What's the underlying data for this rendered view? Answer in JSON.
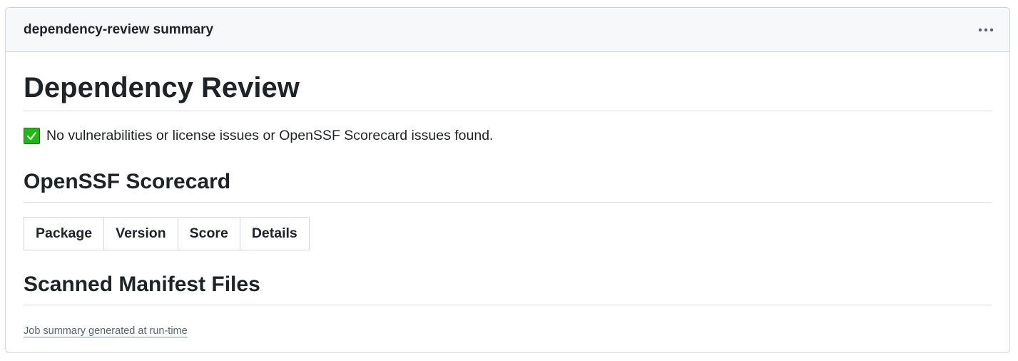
{
  "header": {
    "title": "dependency-review summary",
    "menu_icon": "kebab-horizontal-icon"
  },
  "content": {
    "title": "Dependency Review",
    "status": {
      "icon": "check-mark-icon",
      "text": "No vulnerabilities or license issues or OpenSSF Scorecard issues found."
    },
    "scorecard": {
      "heading": "OpenSSF Scorecard",
      "columns": [
        "Package",
        "Version",
        "Score",
        "Details"
      ]
    },
    "manifest": {
      "heading": "Scanned Manifest Files"
    },
    "footer_link": "Job summary generated at run-time"
  },
  "colors": {
    "accent_green": "#1fb814",
    "border": "#d0d7de",
    "header_bg": "#f6f8fa"
  }
}
